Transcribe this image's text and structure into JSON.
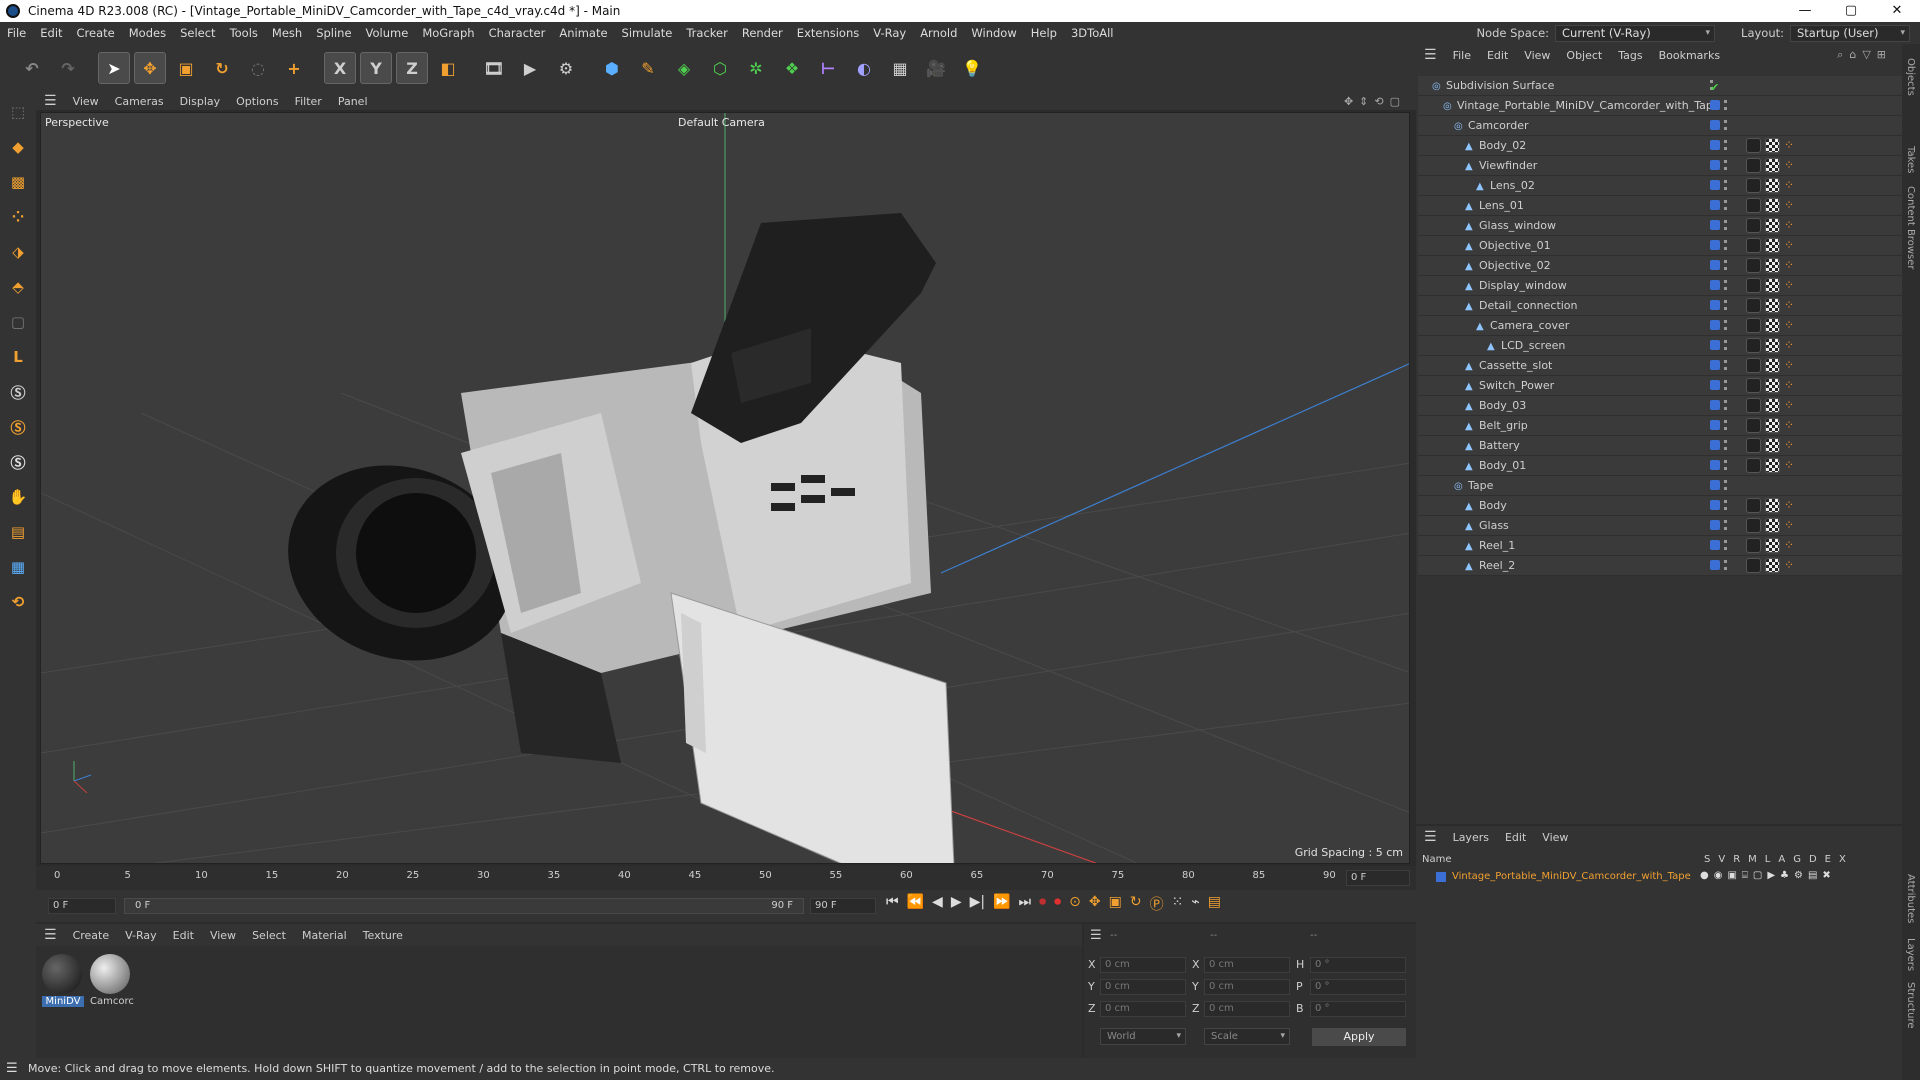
{
  "window": {
    "title": "Cinema 4D R23.008 (RC) - [Vintage_Portable_MiniDV_Camcorder_with_Tape_c4d_vray.c4d *] - Main",
    "min": "—",
    "max": "▢",
    "close": "✕"
  },
  "menu": [
    "File",
    "Edit",
    "Create",
    "Modes",
    "Select",
    "Tools",
    "Mesh",
    "Spline",
    "Volume",
    "MoGraph",
    "Character",
    "Animate",
    "Simulate",
    "Tracker",
    "Render",
    "Extensions",
    "V-Ray",
    "Arnold",
    "Window",
    "Help",
    "3DToAll"
  ],
  "nodespace": {
    "label": "Node Space:",
    "value": "Current (V-Ray)"
  },
  "layout": {
    "label": "Layout:",
    "value": "Startup (User)"
  },
  "toolbar": {
    "x": "X",
    "y": "Y",
    "z": "Z"
  },
  "viewport": {
    "menu": [
      "View",
      "Cameras",
      "Display",
      "Options",
      "Filter",
      "Panel"
    ],
    "name": "Perspective",
    "camera": "Default Camera",
    "grid": "Grid Spacing : 5 cm"
  },
  "timeline": {
    "ticks": [
      "0",
      "5",
      "10",
      "15",
      "20",
      "25",
      "30",
      "35",
      "40",
      "45",
      "50",
      "55",
      "60",
      "65",
      "70",
      "75",
      "80",
      "85",
      "90"
    ],
    "end": "0 F",
    "start_field": "0 F",
    "range_start": "0 F",
    "range_end": "90 F",
    "max_field": "90 F"
  },
  "material_manager": {
    "menu": [
      "Create",
      "V-Ray",
      "Edit",
      "View",
      "Select",
      "Material",
      "Texture"
    ],
    "materials": [
      "MiniDV",
      "Camcorc"
    ]
  },
  "coords": {
    "headers": [
      "--",
      "--",
      "--"
    ],
    "rows": [
      {
        "a": "X",
        "av": "0 cm",
        "b": "X",
        "bv": "0 cm",
        "c": "H",
        "cv": "0 °"
      },
      {
        "a": "Y",
        "av": "0 cm",
        "b": "Y",
        "bv": "0 cm",
        "c": "P",
        "cv": "0 °"
      },
      {
        "a": "Z",
        "av": "0 cm",
        "b": "Z",
        "bv": "0 cm",
        "c": "B",
        "cv": "0 °"
      }
    ],
    "world": "World",
    "scale": "Scale",
    "apply": "Apply"
  },
  "status": "Move: Click and drag to move elements. Hold down SHIFT to quantize movement / add to the selection in point mode, CTRL to remove.",
  "objects": {
    "menu": [
      "File",
      "Edit",
      "View",
      "Object",
      "Tags",
      "Bookmarks"
    ],
    "items": [
      {
        "name": "Subdivision Surface",
        "depth": 0,
        "tags": "chk"
      },
      {
        "name": "Vintage_Portable_MiniDV_Camcorder_with_Tape",
        "depth": 1,
        "tags": ""
      },
      {
        "name": "Camcorder",
        "depth": 2,
        "tags": ""
      },
      {
        "name": "Body_02",
        "depth": 3,
        "tags": "t"
      },
      {
        "name": "Viewfinder",
        "depth": 3,
        "tags": "t"
      },
      {
        "name": "Lens_02",
        "depth": 4,
        "tags": "t"
      },
      {
        "name": "Lens_01",
        "depth": 3,
        "tags": "t"
      },
      {
        "name": "Glass_window",
        "depth": 3,
        "tags": "t"
      },
      {
        "name": "Objective_01",
        "depth": 3,
        "tags": "t"
      },
      {
        "name": "Objective_02",
        "depth": 3,
        "tags": "t"
      },
      {
        "name": "Display_window",
        "depth": 3,
        "tags": "t"
      },
      {
        "name": "Detail_connection",
        "depth": 3,
        "tags": "t"
      },
      {
        "name": "Camera_cover",
        "depth": 4,
        "tags": "t"
      },
      {
        "name": "LCD_screen",
        "depth": 5,
        "tags": "t"
      },
      {
        "name": "Cassette_slot",
        "depth": 3,
        "tags": "t"
      },
      {
        "name": "Switch_Power",
        "depth": 3,
        "tags": "t"
      },
      {
        "name": "Body_03",
        "depth": 3,
        "tags": "t"
      },
      {
        "name": "Belt_grip",
        "depth": 3,
        "tags": "t"
      },
      {
        "name": "Battery",
        "depth": 3,
        "tags": "t"
      },
      {
        "name": "Body_01",
        "depth": 3,
        "tags": "t"
      },
      {
        "name": "Tape",
        "depth": 2,
        "tags": ""
      },
      {
        "name": "Body",
        "depth": 3,
        "tags": "t"
      },
      {
        "name": "Glass",
        "depth": 3,
        "tags": "t"
      },
      {
        "name": "Reel_1",
        "depth": 3,
        "tags": "t"
      },
      {
        "name": "Reel_2",
        "depth": 3,
        "tags": "t"
      }
    ]
  },
  "layers": {
    "menu": [
      "Layers",
      "Edit",
      "View"
    ],
    "col_name": "Name",
    "cols": [
      "S",
      "V",
      "R",
      "M",
      "L",
      "A",
      "G",
      "D",
      "E",
      "X"
    ],
    "item": "Vintage_Portable_MiniDV_Camcorder_with_Tape"
  },
  "sidetabs": [
    "Objects",
    "Takes",
    "Content Browser",
    "Attributes",
    "Layers",
    "Structure"
  ]
}
